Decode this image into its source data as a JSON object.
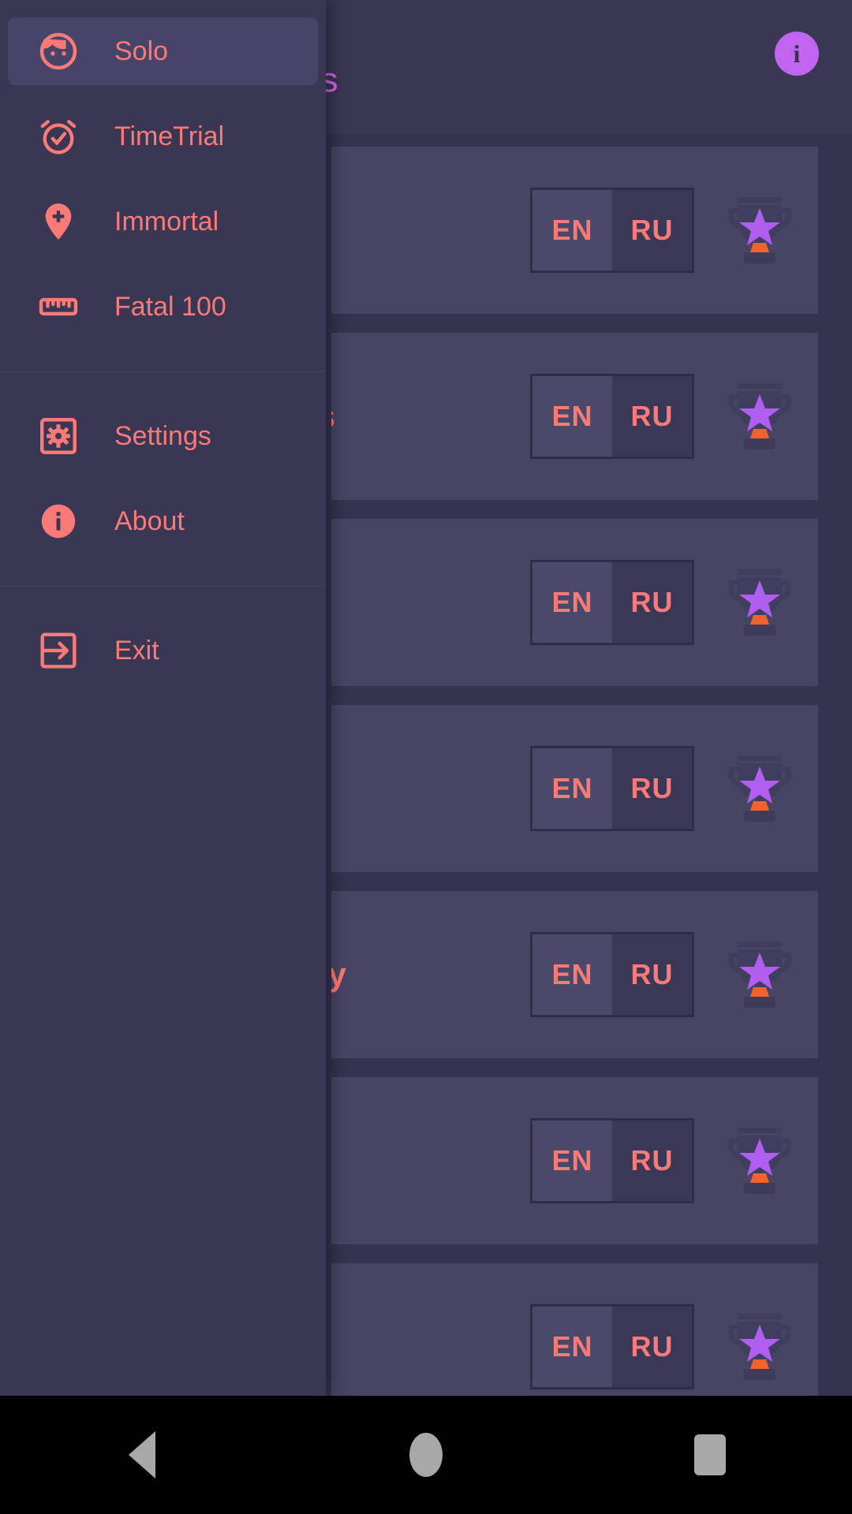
{
  "header": {
    "title": "ints",
    "title_color": "#e45ff0",
    "info_button": {
      "name": "info-button",
      "glyph": "i",
      "color": "#c164f0"
    }
  },
  "theme": {
    "background": "#35334e",
    "surface": "#393754",
    "card": "#474564",
    "accent": "#fa7a77",
    "accent_magenta": "#e45ff0",
    "accent_purple": "#c164f0",
    "selected_item": "#464469",
    "toggle_border": "#2f2d47",
    "toggle_on": "#4b4969",
    "toggle_off": "#3a3856"
  },
  "drawer": {
    "open": true,
    "groups": [
      {
        "items": [
          {
            "label": "Solo",
            "icon": "face-icon",
            "selected": true
          },
          {
            "label": "TimeTrial",
            "icon": "alarm-check-icon",
            "selected": false
          },
          {
            "label": "Immortal",
            "icon": "map-pin-plus-icon",
            "selected": false
          },
          {
            "label": "Fatal 100",
            "icon": "ruler-icon",
            "selected": false
          }
        ]
      },
      {
        "items": [
          {
            "label": "Settings",
            "icon": "settings-box-icon",
            "selected": false
          },
          {
            "label": "About",
            "icon": "info-circle-icon",
            "selected": false
          }
        ]
      },
      {
        "items": [
          {
            "label": "Exit",
            "icon": "exit-icon",
            "selected": false
          }
        ]
      }
    ]
  },
  "content": {
    "language_options": {
      "left": "EN",
      "right": "RU",
      "selected": "EN"
    },
    "cards": [
      {
        "title": "",
        "lang_selected": "EN",
        "trophy": "trophy-star-icon"
      },
      {
        "title": "ls",
        "lang_selected": "EN",
        "trophy": "trophy-star-icon"
      },
      {
        "title": "",
        "lang_selected": "EN",
        "trophy": "trophy-star-icon"
      },
      {
        "title": "",
        "lang_selected": "EN",
        "trophy": "trophy-star-icon"
      },
      {
        "title": "ny",
        "lang_selected": "EN",
        "trophy": "trophy-star-icon"
      },
      {
        "title": ")",
        "lang_selected": "EN",
        "trophy": "trophy-star-icon"
      },
      {
        "title": "",
        "lang_selected": "EN",
        "trophy": "trophy-star-icon"
      }
    ]
  },
  "system_nav": {
    "back": "back-button",
    "home": "home-button",
    "recents": "recents-button"
  }
}
